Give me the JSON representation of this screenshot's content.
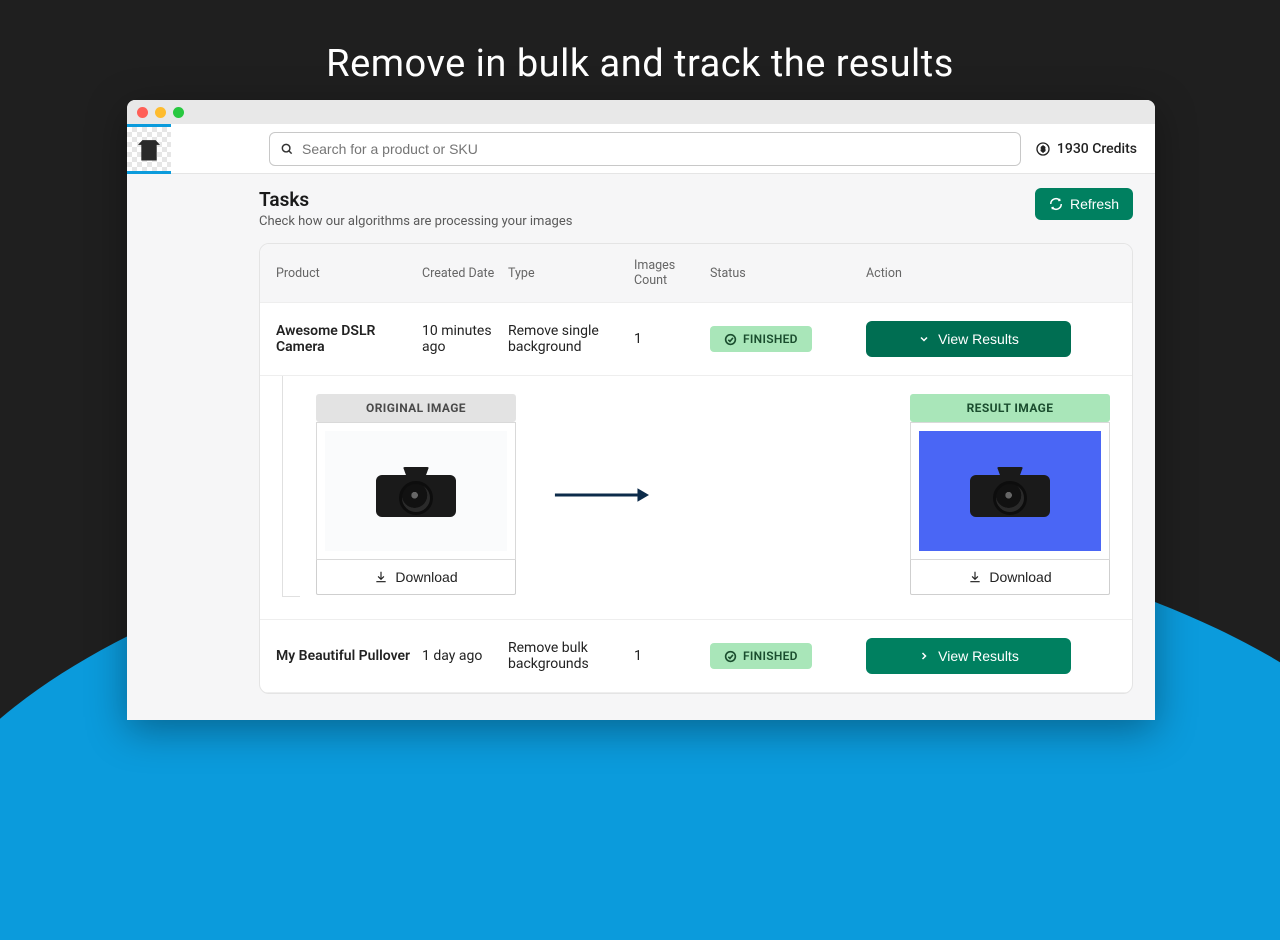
{
  "hero": {
    "title": "Remove in bulk and track the results"
  },
  "header": {
    "search_placeholder": "Search for a product or SKU",
    "credits_label": "1930 Credits"
  },
  "page": {
    "title": "Tasks",
    "subtitle": "Check how our algorithms are processing your images",
    "refresh_label": "Refresh"
  },
  "table": {
    "columns": {
      "product": "Product",
      "created": "Created Date",
      "type": "Type",
      "images": "Images Count",
      "status": "Status",
      "action": "Action"
    }
  },
  "tasks": [
    {
      "product": "Awesome DSLR Camera",
      "created": "10 minutes ago",
      "type": "Remove single background",
      "images_count": "1",
      "status": "FINISHED",
      "action_label": "View Results",
      "expanded": {
        "original_label": "ORIGINAL IMAGE",
        "result_label": "RESULT IMAGE",
        "download_label": "Download"
      }
    },
    {
      "product": "My Beautiful Pullover",
      "created": "1 day ago",
      "type": "Remove bulk backgrounds",
      "images_count": "1",
      "status": "FINISHED",
      "action_label": "View Results"
    }
  ]
}
